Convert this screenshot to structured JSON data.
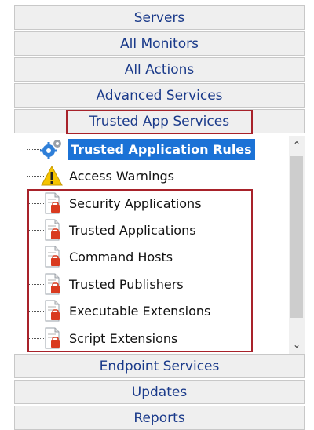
{
  "nav_top": [
    {
      "label": "Servers"
    },
    {
      "label": "All Monitors"
    },
    {
      "label": "All Actions"
    },
    {
      "label": "Advanced Services"
    },
    {
      "label": "Trusted App Services"
    }
  ],
  "tree": {
    "items": [
      {
        "label": "Trusted Application Rules",
        "icon": "gears-icon",
        "selected": true
      },
      {
        "label": "Access Warnings",
        "icon": "warning-icon"
      },
      {
        "label": "Security Applications",
        "icon": "document-icon"
      },
      {
        "label": "Trusted Applications",
        "icon": "document-icon"
      },
      {
        "label": "Command Hosts",
        "icon": "document-icon"
      },
      {
        "label": "Trusted Publishers",
        "icon": "document-icon"
      },
      {
        "label": "Executable Extensions",
        "icon": "document-icon"
      },
      {
        "label": "Script Extensions",
        "icon": "document-icon"
      }
    ]
  },
  "nav_bottom": [
    {
      "label": "Endpoint Services"
    },
    {
      "label": "Updates"
    },
    {
      "label": "Reports"
    }
  ],
  "colors": {
    "accent": "#1b72d6",
    "highlight_outline": "#a8222a",
    "nav_text": "#1a3a8a"
  }
}
